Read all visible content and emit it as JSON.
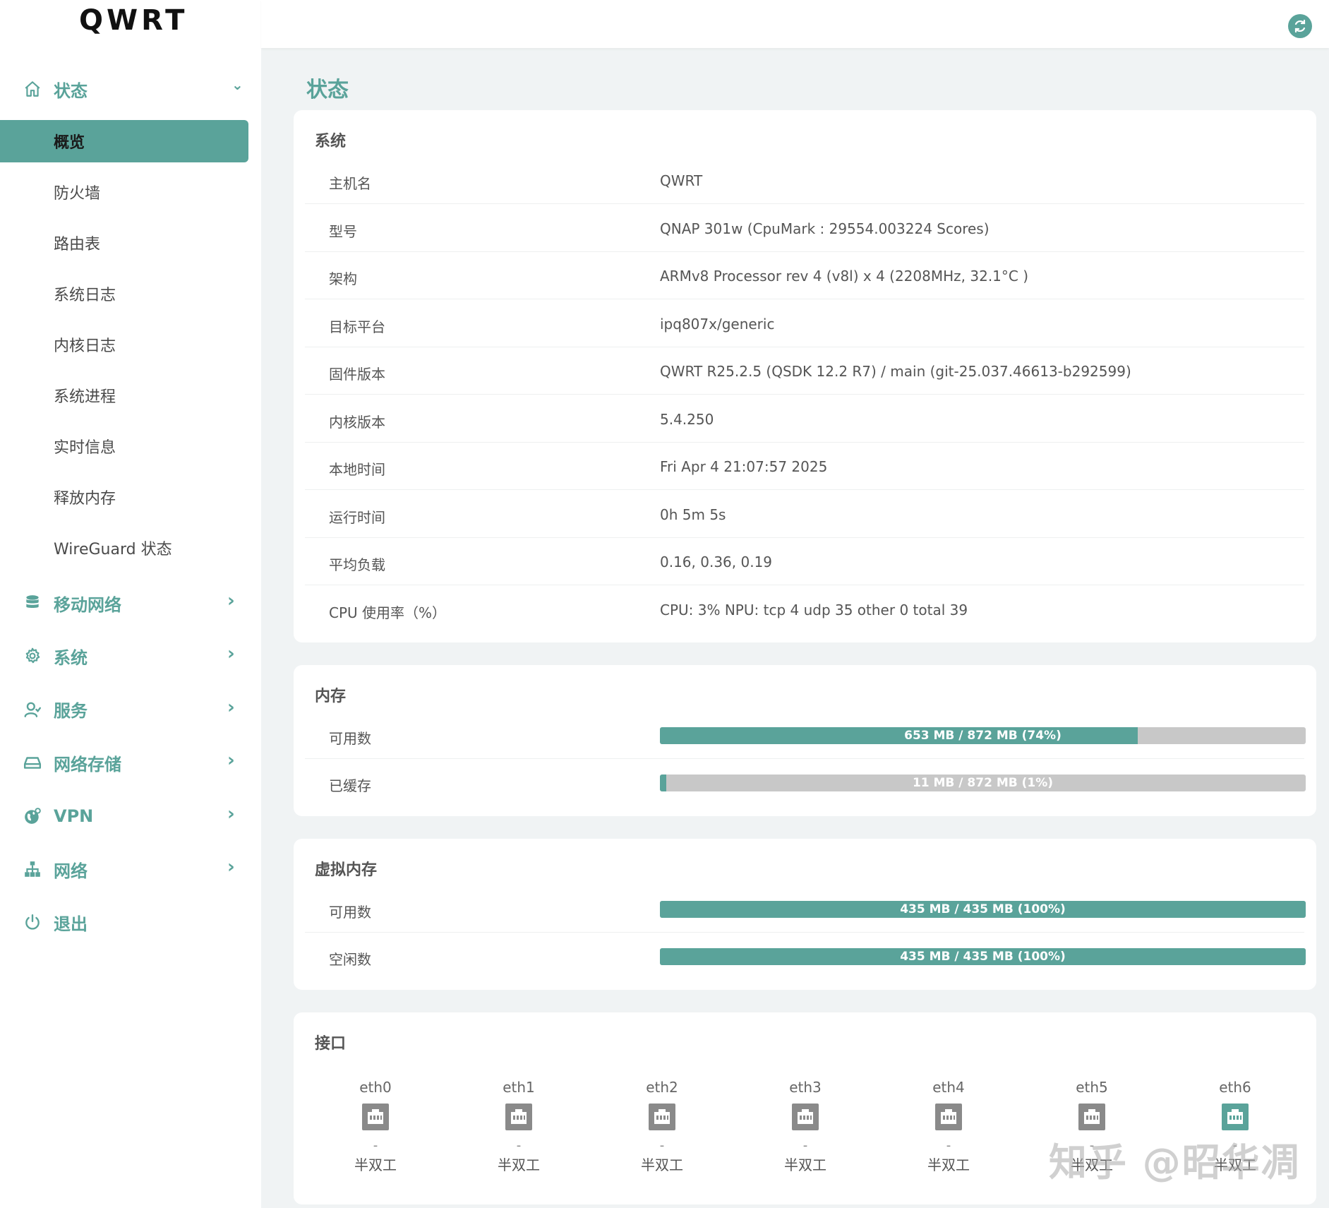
{
  "app": {
    "logo": "QWRT"
  },
  "sidebar": {
    "status": {
      "label": "状态",
      "chevron": "⌄",
      "icon": "home-icon"
    },
    "status_items": [
      {
        "label": "概览",
        "active": true
      },
      {
        "label": "防火墙"
      },
      {
        "label": "路由表"
      },
      {
        "label": "系统日志"
      },
      {
        "label": "内核日志"
      },
      {
        "label": "系统进程"
      },
      {
        "label": "实时信息"
      },
      {
        "label": "释放内存"
      },
      {
        "label": "WireGuard 状态"
      }
    ],
    "groups": [
      {
        "label": "移动网络",
        "chevron": "›",
        "icon": "database-icon"
      },
      {
        "label": "系统",
        "chevron": "›",
        "icon": "gear-icon"
      },
      {
        "label": "服务",
        "chevron": "›",
        "icon": "user-icon"
      },
      {
        "label": "网络存储",
        "chevron": "›",
        "icon": "hard-drive-icon"
      },
      {
        "label": "VPN",
        "chevron": "›",
        "icon": "globe-icon"
      },
      {
        "label": "网络",
        "chevron": "›",
        "icon": "network-icon"
      }
    ],
    "logout": {
      "label": "退出",
      "icon": "power-icon"
    }
  },
  "page": {
    "title": "状态"
  },
  "system": {
    "title": "系统",
    "rows": [
      {
        "key": "主机名",
        "value": "QWRT"
      },
      {
        "key": "型号",
        "value": "QNAP 301w (CpuMark : 29554.003224 Scores)"
      },
      {
        "key": "架构",
        "value": "ARMv8 Processor rev 4 (v8l) x 4 (2208MHz, 32.1°C )"
      },
      {
        "key": "目标平台",
        "value": "ipq807x/generic"
      },
      {
        "key": "固件版本",
        "value": "QWRT R25.2.5 (QSDK 12.2 R7) / main (git-25.037.46613-b292599)"
      },
      {
        "key": "内核版本",
        "value": "5.4.250"
      },
      {
        "key": "本地时间",
        "value": "Fri Apr 4 21:07:57 2025"
      },
      {
        "key": "运行时间",
        "value": "0h 5m 5s"
      },
      {
        "key": "平均负载",
        "value": "0.16, 0.36, 0.19"
      },
      {
        "key": "CPU 使用率（%）",
        "value": "CPU: 3% NPU: tcp 4 udp 35 other 0 total 39"
      }
    ]
  },
  "memory": {
    "title": "内存",
    "rows": [
      {
        "key": "可用数",
        "text": "653 MB / 872 MB (74%)",
        "percent": 74
      },
      {
        "key": "已缓存",
        "text": "11 MB / 872 MB (1%)",
        "percent": 1
      }
    ]
  },
  "swap": {
    "title": "虚拟内存",
    "rows": [
      {
        "key": "可用数",
        "text": "435 MB / 435 MB (100%)",
        "percent": 100
      },
      {
        "key": "空闲数",
        "text": "435 MB / 435 MB (100%)",
        "percent": 100
      }
    ]
  },
  "interfaces": {
    "title": "接口",
    "items": [
      {
        "name": "eth0",
        "speed": "-",
        "duplex": "半双工",
        "active": false
      },
      {
        "name": "eth1",
        "speed": "-",
        "duplex": "半双工",
        "active": false
      },
      {
        "name": "eth2",
        "speed": "-",
        "duplex": "半双工",
        "active": false
      },
      {
        "name": "eth3",
        "speed": "-",
        "duplex": "半双工",
        "active": false
      },
      {
        "name": "eth4",
        "speed": "-",
        "duplex": "半双工",
        "active": false
      },
      {
        "name": "eth5",
        "speed": "-",
        "duplex": "半双工",
        "active": false
      },
      {
        "name": "eth6",
        "speed": "-",
        "duplex": "半双工",
        "active": true
      }
    ]
  },
  "colors": {
    "accent": "#5aa39a",
    "bar_bg": "#c8c8c8",
    "port_inactive": "#8a8a8a"
  },
  "watermark": "知乎 @昭华凋"
}
